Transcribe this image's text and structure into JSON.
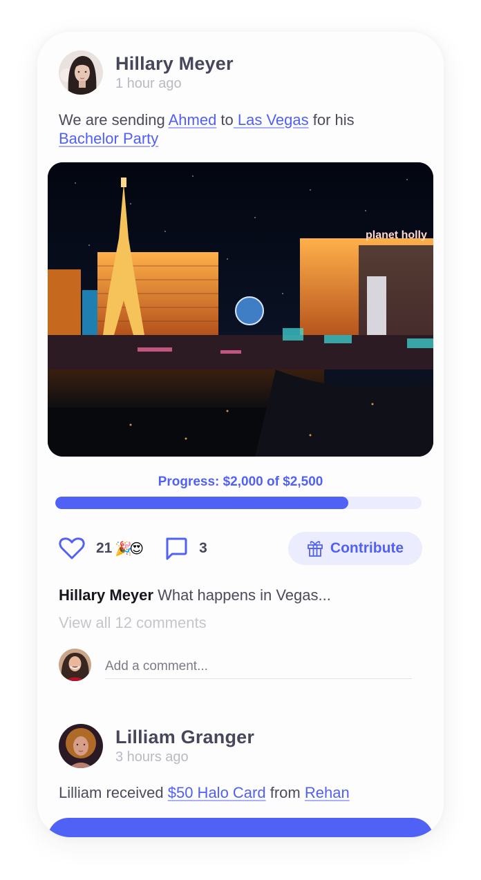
{
  "colors": {
    "accent": "#5061f5",
    "accent_light": "#ebecfd",
    "text": "#4a4b5b",
    "muted": "#b9b9c1"
  },
  "posts": [
    {
      "author": "Hillary Meyer",
      "time": "1 hour ago",
      "text_parts": [
        "We are sending ",
        "Ahmed",
        " to",
        " Las Vegas",
        " for his ",
        "Bachelor Party"
      ],
      "image_alt": "Las Vegas Strip at night with Eiffel Tower replica and Planet Hollywood",
      "image_sign": "planet holly",
      "progress": {
        "label": "Progress: $2,000 of $2,500",
        "raised": 2000,
        "goal": 2500,
        "fraction": 0.8
      },
      "likes": {
        "icon": "heart-icon",
        "count": "21",
        "reactions": "🎉😍"
      },
      "comments": {
        "icon": "comment-icon",
        "count": "3"
      },
      "contribute": {
        "icon": "gift-icon",
        "label": "Contribute"
      },
      "top_comment": {
        "author": "Hillary Meyer",
        "text": "What happens in Vegas..."
      },
      "view_all": "View all 12 comments",
      "add_comment_placeholder": "Add a comment..."
    },
    {
      "author": "Lilliam Granger",
      "time": "3 hours ago",
      "text_parts": [
        "Lilliam received ",
        "$50 Halo Card",
        " from ",
        "Rehan"
      ]
    }
  ]
}
